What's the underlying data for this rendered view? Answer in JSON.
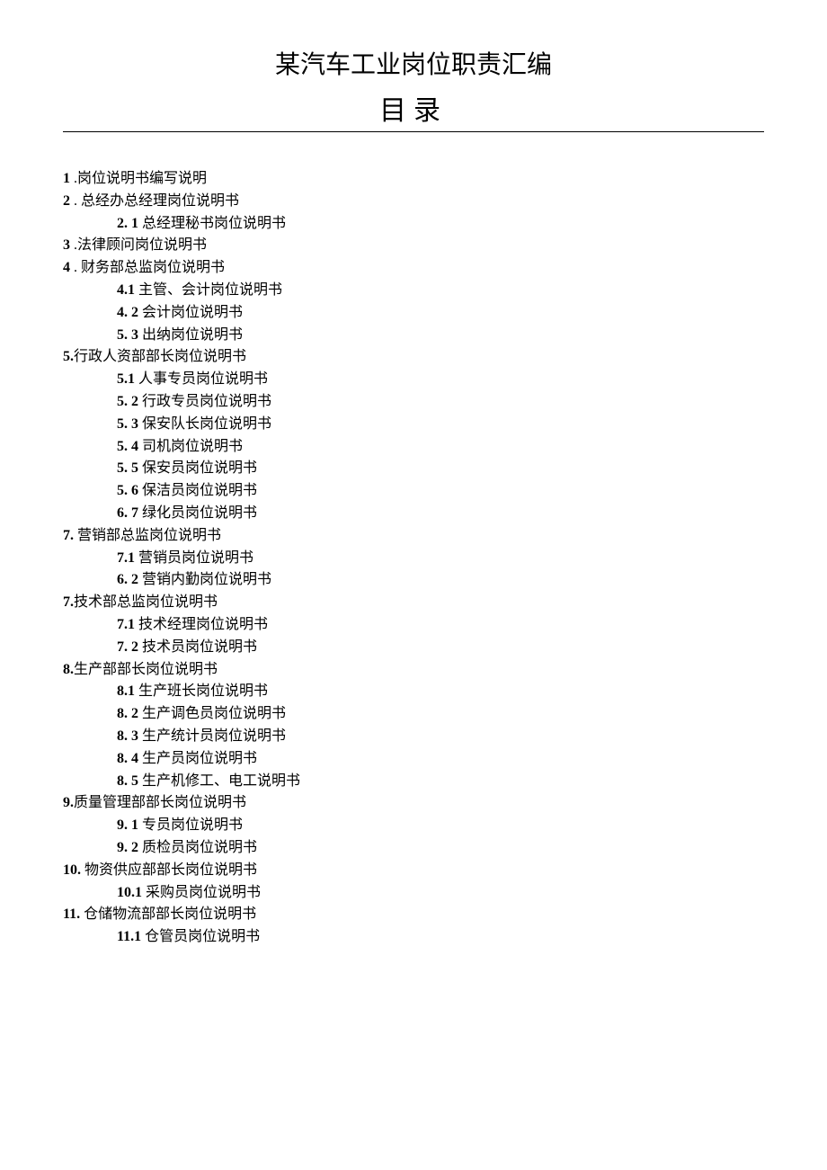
{
  "title": "某汽车工业岗位职责汇编",
  "subtitle": "目录",
  "items": [
    {
      "level": 1,
      "num": "1 ",
      "text": ".岗位说明书编写说明"
    },
    {
      "level": 1,
      "num": "2 ",
      "text": ". 总经办总经理岗位说明书"
    },
    {
      "level": 2,
      "num": "2.   1 ",
      "text": "总经理秘书岗位说明书"
    },
    {
      "level": 1,
      "num": "3 ",
      "text": ".法律顾问岗位说明书"
    },
    {
      "level": 1,
      "num": "4 ",
      "text": ". 财务部总监岗位说明书"
    },
    {
      "level": 2,
      "num": "4.1 ",
      "text": "  主管、会计岗位说明书"
    },
    {
      "level": 2,
      "num": "4.   2 ",
      "text": "会计岗位说明书"
    },
    {
      "level": 2,
      "num": "5.   3 ",
      "text": "出纳岗位说明书"
    },
    {
      "level": 1,
      "num": "5.",
      "text": "行政人资部部长岗位说明书"
    },
    {
      "level": 2,
      "num": "5.1 ",
      "text": "  人事专员岗位说明书"
    },
    {
      "level": 2,
      "num": "5.   2 ",
      "text": "行政专员岗位说明书"
    },
    {
      "level": 2,
      "num": "5.   3 ",
      "text": "保安队长岗位说明书"
    },
    {
      "level": 2,
      "num": "5.   4 ",
      "text": "司机岗位说明书"
    },
    {
      "level": 2,
      "num": "5.   5 ",
      "text": "保安员岗位说明书"
    },
    {
      "level": 2,
      "num": "5.   6 ",
      "text": "保洁员岗位说明书"
    },
    {
      "level": 2,
      "num": "6.   7 ",
      "text": "绿化员岗位说明书"
    },
    {
      "level": 1,
      "num": "7. ",
      "text": "  营销部总监岗位说明书"
    },
    {
      "level": 2,
      "num": "7.1 ",
      "text": "  营销员岗位说明书"
    },
    {
      "level": 2,
      "num": "6.   2 ",
      "text": "营销内勤岗位说明书"
    },
    {
      "level": 1,
      "num": "7.",
      "text": "技术部总监岗位说明书"
    },
    {
      "level": 2,
      "num": "7.1 ",
      "text": "  技术经理岗位说明书"
    },
    {
      "level": 2,
      "num": "7.   2 ",
      "text": "技术员岗位说明书"
    },
    {
      "level": 1,
      "num": "8.",
      "text": "生产部部长岗位说明书"
    },
    {
      "level": 2,
      "num": "8.1 ",
      "text": "  生产班长岗位说明书"
    },
    {
      "level": 2,
      "num": "8.   2 ",
      "text": "生产调色员岗位说明书"
    },
    {
      "level": 2,
      "num": "8.   3 ",
      "text": "生产统计员岗位说明书"
    },
    {
      "level": 2,
      "num": "8.   4 ",
      "text": "生产员岗位说明书"
    },
    {
      "level": 2,
      "num": "8.   5 ",
      "text": "生产机修工、电工说明书"
    },
    {
      "level": 1,
      "num": "9.",
      "text": "质量管理部部长岗位说明书"
    },
    {
      "level": 2,
      "num": "9.   1 ",
      "text": "专员岗位说明书"
    },
    {
      "level": 2,
      "num": "9.   2 ",
      "text": "质检员岗位说明书"
    },
    {
      "level": 1,
      "num": "10. ",
      "text": "  物资供应部部长岗位说明书"
    },
    {
      "level": 2,
      "num": "10.1 ",
      "text": "  采购员岗位说明书"
    },
    {
      "level": 1,
      "num": "11. ",
      "text": "  仓储物流部部长岗位说明书"
    },
    {
      "level": 2,
      "num": "11.1 ",
      "text": "  仓管员岗位说明书"
    }
  ]
}
